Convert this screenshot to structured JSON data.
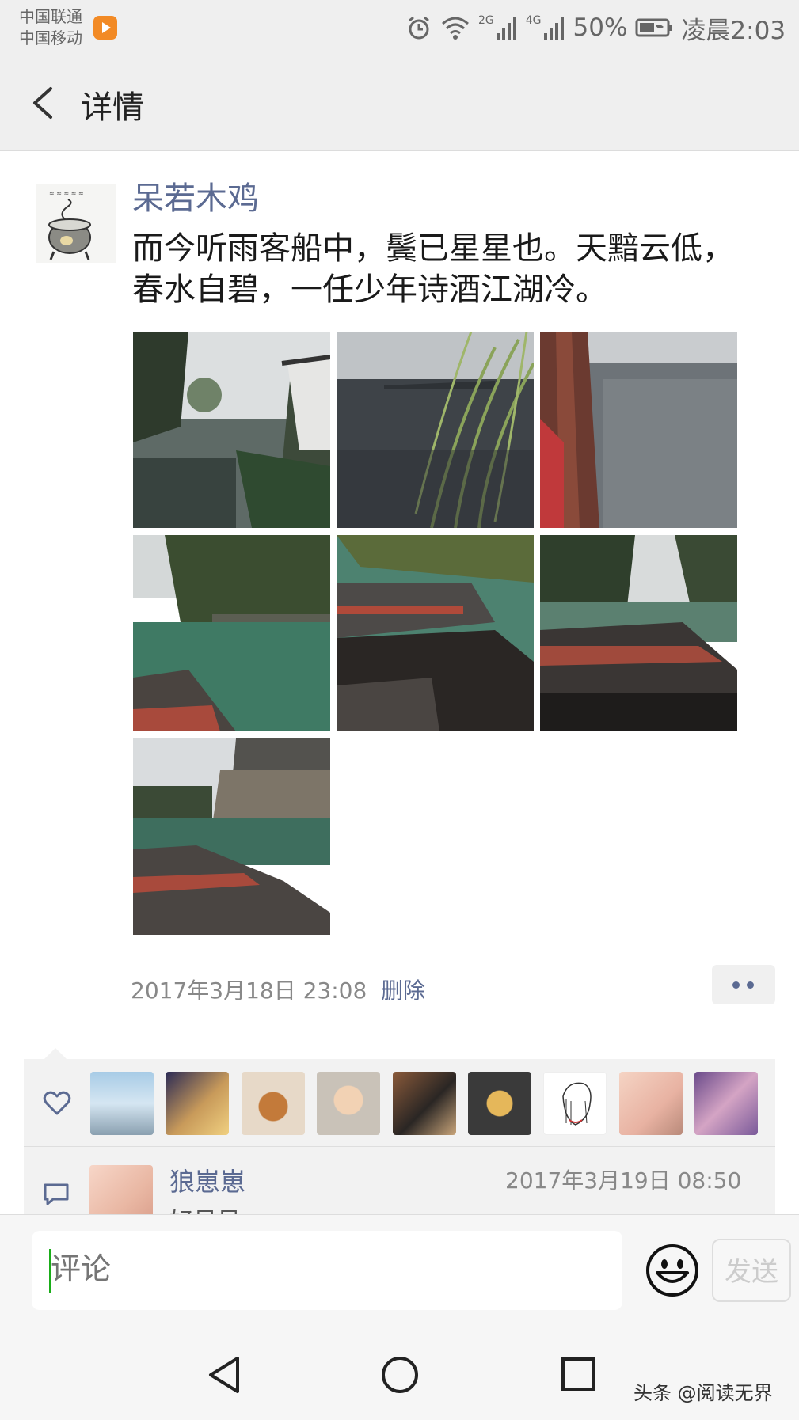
{
  "status_bar": {
    "carrier1": "中国联通",
    "carrier2": "中国移动",
    "net1": "2G",
    "net2": "4G",
    "battery": "50%",
    "time": "凌晨2:03"
  },
  "header": {
    "title": "详情"
  },
  "post": {
    "author": "呆若木鸡",
    "text": "而今听雨客船中，鬓已星星也。天黯云低，春水自碧，一任少年诗酒江湖冷。",
    "photo_count": 7,
    "timestamp": "2017年3月18日 23:08",
    "delete_label": "删除"
  },
  "likes": {
    "count": 9
  },
  "comments": [
    {
      "author": "狼崽崽",
      "time": "2017年3月19日 08:50",
      "text": "好呆呆"
    }
  ],
  "input": {
    "placeholder": "评论",
    "send_label": "发送"
  },
  "watermark": "头条 @阅读无界",
  "colors": {
    "link": "#5b6a92",
    "cursor": "#1aad19"
  }
}
